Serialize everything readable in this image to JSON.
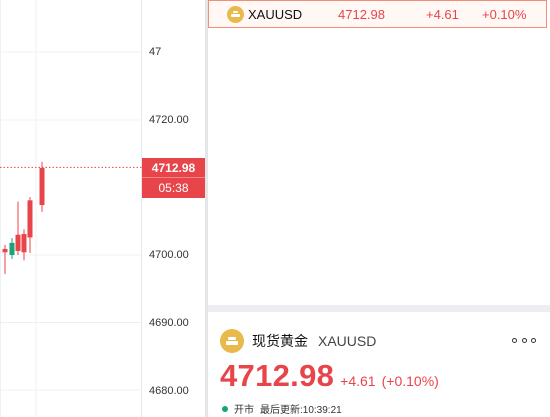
{
  "colors": {
    "up": "#e8454b",
    "candle_up": "#e8454b",
    "candle_down": "#1aa37a",
    "gold": "#e9b94b",
    "status_dot": "#1aa37a"
  },
  "chart": {
    "axis_labels": [
      "47",
      "4720.00",
      "4700.00",
      "4690.00",
      "4680.00"
    ],
    "current_price": "4712.98",
    "countdown": "05:38",
    "candles": [
      {
        "open": 4700.4,
        "close": 4700.9,
        "high": 4701.5,
        "low": 4697.2
      },
      {
        "open": 4701.8,
        "close": 4700.0,
        "high": 4702.5,
        "low": 4699.4
      },
      {
        "open": 4700.6,
        "close": 4703.0,
        "high": 4707.9,
        "low": 4700.0
      },
      {
        "open": 4700.4,
        "close": 4703.1,
        "high": 4703.8,
        "low": 4699.2
      },
      {
        "open": 4702.6,
        "close": 4708.1,
        "high": 4708.6,
        "low": 4700.3
      },
      {
        "open": 4707.4,
        "close": 4712.9,
        "high": 4713.8,
        "low": 4706.4
      }
    ]
  },
  "watchlist": {
    "row": {
      "icon": "gold-bar-icon",
      "symbol": "XAUUSD",
      "price": "4712.98",
      "change": "+4.61",
      "pct": "+0.10%"
    }
  },
  "detail": {
    "icon": "gold-bar-icon",
    "name": "现货黄金",
    "code": "XAUUSD",
    "price": "4712.98",
    "change": "+4.61",
    "pct": "(+0.10%)",
    "status": "开市",
    "updated": "最后更新:10:39:21",
    "more_icon": "more-icon"
  }
}
